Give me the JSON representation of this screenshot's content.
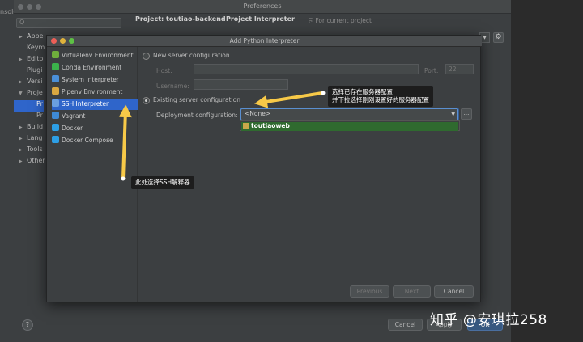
{
  "left_edge_text": "nsole",
  "preferences": {
    "title": "Preferences",
    "search_placeholder": "Q",
    "breadcrumb_project": "Project: toutiao-backend",
    "breadcrumb_sep": "›",
    "breadcrumb_page": "Project Interpreter",
    "breadcrumb_note": "For current project",
    "tree": [
      {
        "label": "Appe",
        "arrow": "▶"
      },
      {
        "label": "Keym",
        "arrow": ""
      },
      {
        "label": "Edito",
        "arrow": "▶"
      },
      {
        "label": "Plugi",
        "arrow": ""
      },
      {
        "label": "Versi",
        "arrow": "▶"
      },
      {
        "label": "Proje",
        "arrow": "▼"
      },
      {
        "label": "Pr",
        "arrow": ""
      },
      {
        "label": "Pr",
        "arrow": ""
      },
      {
        "label": "Build",
        "arrow": "▶"
      },
      {
        "label": "Lang",
        "arrow": "▶"
      },
      {
        "label": "Tools",
        "arrow": "▶"
      },
      {
        "label": "Other",
        "arrow": "▶"
      }
    ],
    "help_label": "?",
    "cancel_label": "Cancel",
    "apply_label": "Apply",
    "ok_label": "OK"
  },
  "dialog": {
    "title": "Add Python Interpreter",
    "interpreters": [
      {
        "label": "Virtualenv Environment",
        "icon_color": "#6fae3c"
      },
      {
        "label": "Conda Environment",
        "icon_color": "#3bb24b"
      },
      {
        "label": "System Interpreter",
        "icon_color": "#4a8fd8"
      },
      {
        "label": "Pipenv Environment",
        "icon_color": "#d9a741"
      },
      {
        "label": "SSH Interpreter",
        "icon_color": "#6a9fe0"
      },
      {
        "label": "Vagrant",
        "icon_color": "#3e8ad6"
      },
      {
        "label": "Docker",
        "icon_color": "#2d9fe6"
      },
      {
        "label": "Docker Compose",
        "icon_color": "#2d9fe6"
      }
    ],
    "new_server_label": "New server configuration",
    "host_label": "Host:",
    "port_label": "Port:",
    "port_value": "22",
    "username_label": "Username:",
    "existing_server_label": "Existing server configuration",
    "deployment_label": "Deployment configuration:",
    "deployment_value": "<None>",
    "deployment_option": "toutiaoweb",
    "ellipsis_label": "...",
    "previous_label": "Previous",
    "next_label": "Next",
    "cancel_label": "Cancel"
  },
  "annotations": {
    "top_line1": "选择已存在服务器配置",
    "top_line2": "并下拉选择刚刚设置好的服务器配置",
    "bottom": "此处选择SSH解释器",
    "arrow_color": "#f7c948"
  },
  "watermark": "知乎 @安琪拉258"
}
